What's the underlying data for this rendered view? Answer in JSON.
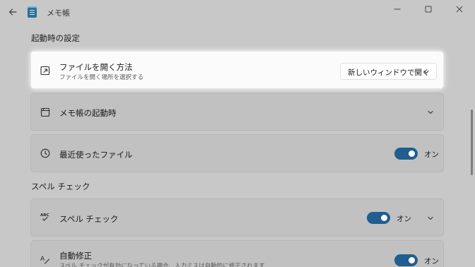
{
  "window": {
    "title": "メモ帳",
    "controls": [
      "minimize",
      "maximize",
      "close"
    ]
  },
  "sections": {
    "startup": {
      "header": "起動時の設定",
      "open_file": {
        "title": "ファイルを開く方法",
        "subtitle": "ファイルを開く場所を選択する",
        "selected": "新しいウィンドウで開く",
        "icon": "open-external-icon"
      },
      "notepad_startup": {
        "title": "メモ帳の起動時",
        "icon": "window-icon"
      },
      "recent_files": {
        "title": "最近使ったファイル",
        "toggle_label": "オン",
        "on": true,
        "icon": "clock-icon"
      }
    },
    "spell": {
      "header": "スペル チェック",
      "spell_check": {
        "title": "スペル チェック",
        "toggle_label": "オン",
        "on": true,
        "icon": "abc-check-icon"
      },
      "autocorrect": {
        "title": "自動修正",
        "subtitle": "スペル チェックが有効になっている場合、入力ミスは自動的に修正されます",
        "toggle_label": "オン",
        "on": true,
        "icon": "autocorrect-icon"
      }
    }
  },
  "colors": {
    "accent": "#1f5e8e",
    "background": "#c8c8c8",
    "card": "#c1c1c1",
    "highlight_card": "#fbfbfb"
  }
}
